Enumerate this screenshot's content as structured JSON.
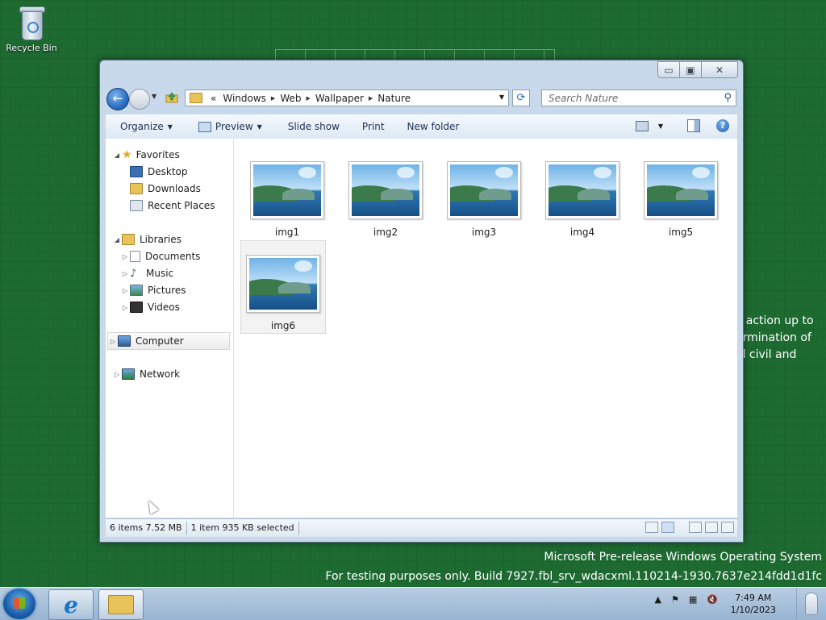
{
  "desktop": {
    "recycle_bin_label": "Recycle Bin",
    "bg_text_lines": [
      "y action up to",
      "ermination of",
      "al civil and"
    ],
    "watermark_line1": "Microsoft Pre-release Windows Operating System",
    "watermark_line2": "For testing purposes only. Build 7927.fbl_srv_wdacxml.110214-1930.7637e214fdd1d1fc"
  },
  "window": {
    "caption": {
      "min": "▭",
      "max": "▣",
      "close": "✕"
    },
    "address": {
      "overflow": "«",
      "crumbs": [
        "Windows",
        "Web",
        "Wallpaper",
        "Nature"
      ]
    },
    "search_placeholder": "Search Nature",
    "toolbar": {
      "organize": "Organize",
      "preview": "Preview",
      "slideshow": "Slide show",
      "print": "Print",
      "new_folder": "New folder"
    },
    "navpane": {
      "favorites": "Favorites",
      "desktop": "Desktop",
      "downloads": "Downloads",
      "recent_places": "Recent Places",
      "libraries": "Libraries",
      "documents": "Documents",
      "music": "Music",
      "pictures": "Pictures",
      "videos": "Videos",
      "computer": "Computer",
      "network": "Network"
    },
    "files": [
      "img1",
      "img2",
      "img3",
      "img4",
      "img5",
      "img6"
    ],
    "selected_file": "img6",
    "status": {
      "count": "6 items 7.52 MB",
      "selection": "1 item 935 KB selected"
    }
  },
  "taskbar": {
    "time": "7:49 AM",
    "date": "1/10/2023"
  },
  "colors": {
    "desktop": "#1e6b32",
    "accent": "#2c6fc4"
  }
}
